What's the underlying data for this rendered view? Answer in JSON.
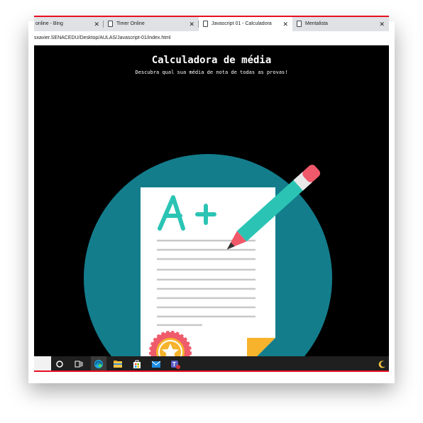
{
  "browser": {
    "tabs": [
      {
        "label": "online - Bing",
        "close": "✕",
        "active": false
      },
      {
        "label": "Timer Online",
        "close": "✕",
        "active": false
      },
      {
        "label": "Javascript 01 - Calculadora",
        "close": "✕",
        "active": true
      },
      {
        "label": "Mentalista",
        "close": "✕",
        "active": false
      }
    ],
    "address": "sxavier.SENACEDU/Desktop/AULAS/Javascript-01/index.html"
  },
  "page": {
    "title": "Calculadora de média",
    "subtitle": "Descubra qual sua média de nota de todas as provas!",
    "illustration": {
      "grade_text": "A+",
      "colors": {
        "circle": "#137d8c",
        "paper": "#ffffff",
        "grade": "#2bc4b4",
        "lines": "#c8c8c8",
        "pencil_body": "#2bc4b4",
        "pencil_cap": "#f0596a",
        "corner_fold": "#f6b32b",
        "badge": "#ef5b6b",
        "star": "#f6b32b"
      }
    }
  },
  "taskbar": {
    "items": [
      "search-icon",
      "cortana-icon",
      "task-view-icon",
      "edge-icon",
      "file-explorer-icon",
      "store-icon",
      "mail-icon",
      "teams-icon",
      "night-mode-icon"
    ]
  }
}
